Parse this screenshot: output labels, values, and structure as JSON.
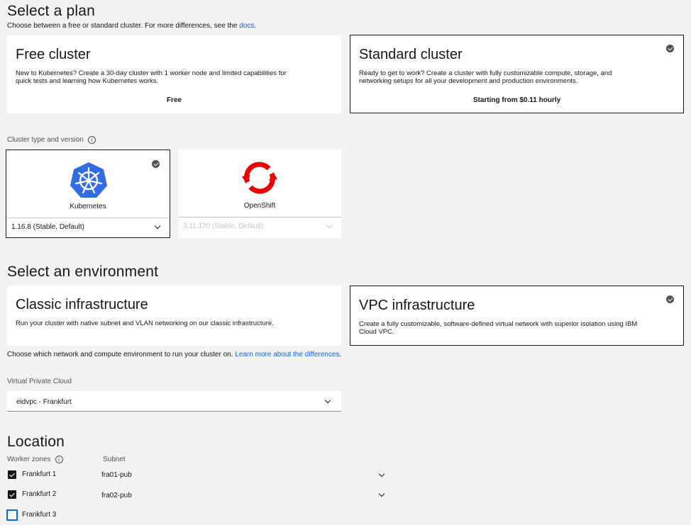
{
  "plan": {
    "title": "Select a plan",
    "subtitle_prefix": "Choose between a free or standard cluster. For more differences, see the ",
    "subtitle_link": "docs",
    "subtitle_suffix": ".",
    "free": {
      "title": "Free cluster",
      "description": "New to Kubernetes? Create a 30-day cluster with 1 worker node and limited capabilities for quick tests and learning how Kubernetes works.",
      "price": "Free"
    },
    "standard": {
      "title": "Standard cluster",
      "description": "Ready to get to work? Create a cluster with fully customizable compute, storage, and networking setups for all your development and production environments.",
      "price": "Starting from $0.11 hourly",
      "selected": true
    }
  },
  "cluster_type": {
    "label": "Cluster type and version",
    "info_icon": "information-icon",
    "kubernetes": {
      "name": "Kubernetes",
      "version": "1.16.8 (Stable, Default)",
      "icon": "kubernetes-logo"
    },
    "openshift": {
      "name": "OpenShift",
      "version": "3.11.170 (Stable, Default)",
      "icon": "openshift-logo"
    }
  },
  "environment": {
    "title": "Select an environment",
    "classic": {
      "title": "Classic infrastructure",
      "description": "Run your cluster with native subnet and VLAN networking on our classic infrastructure."
    },
    "vpc": {
      "title": "VPC infrastructure",
      "description": "Create a fully customizable, software-defined virtual network with superior isolation using IBM Cloud VPC.",
      "selected": true
    },
    "help_prefix": "Choose which network and compute environment to run your cluster on. ",
    "help_link": "Learn more about the differences",
    "help_suffix": "."
  },
  "vpc": {
    "label": "Virtual Private Cloud",
    "value": "eidvpc - Frankfurt"
  },
  "location": {
    "title": "Location",
    "col_zones": "Worker zones",
    "col_subnet": "Subnet",
    "zones": [
      {
        "name": "Frankfurt 1",
        "subnet": "fra01-pub",
        "checked": true
      },
      {
        "name": "Frankfurt 2",
        "subnet": "fra02-pub",
        "checked": true
      },
      {
        "name": "Frankfurt 3",
        "subnet": "",
        "checked": false
      }
    ]
  },
  "colors": {
    "accent": "#0f62fe",
    "openshift_red": "#ee0000",
    "kubernetes_blue": "#326ce5"
  }
}
